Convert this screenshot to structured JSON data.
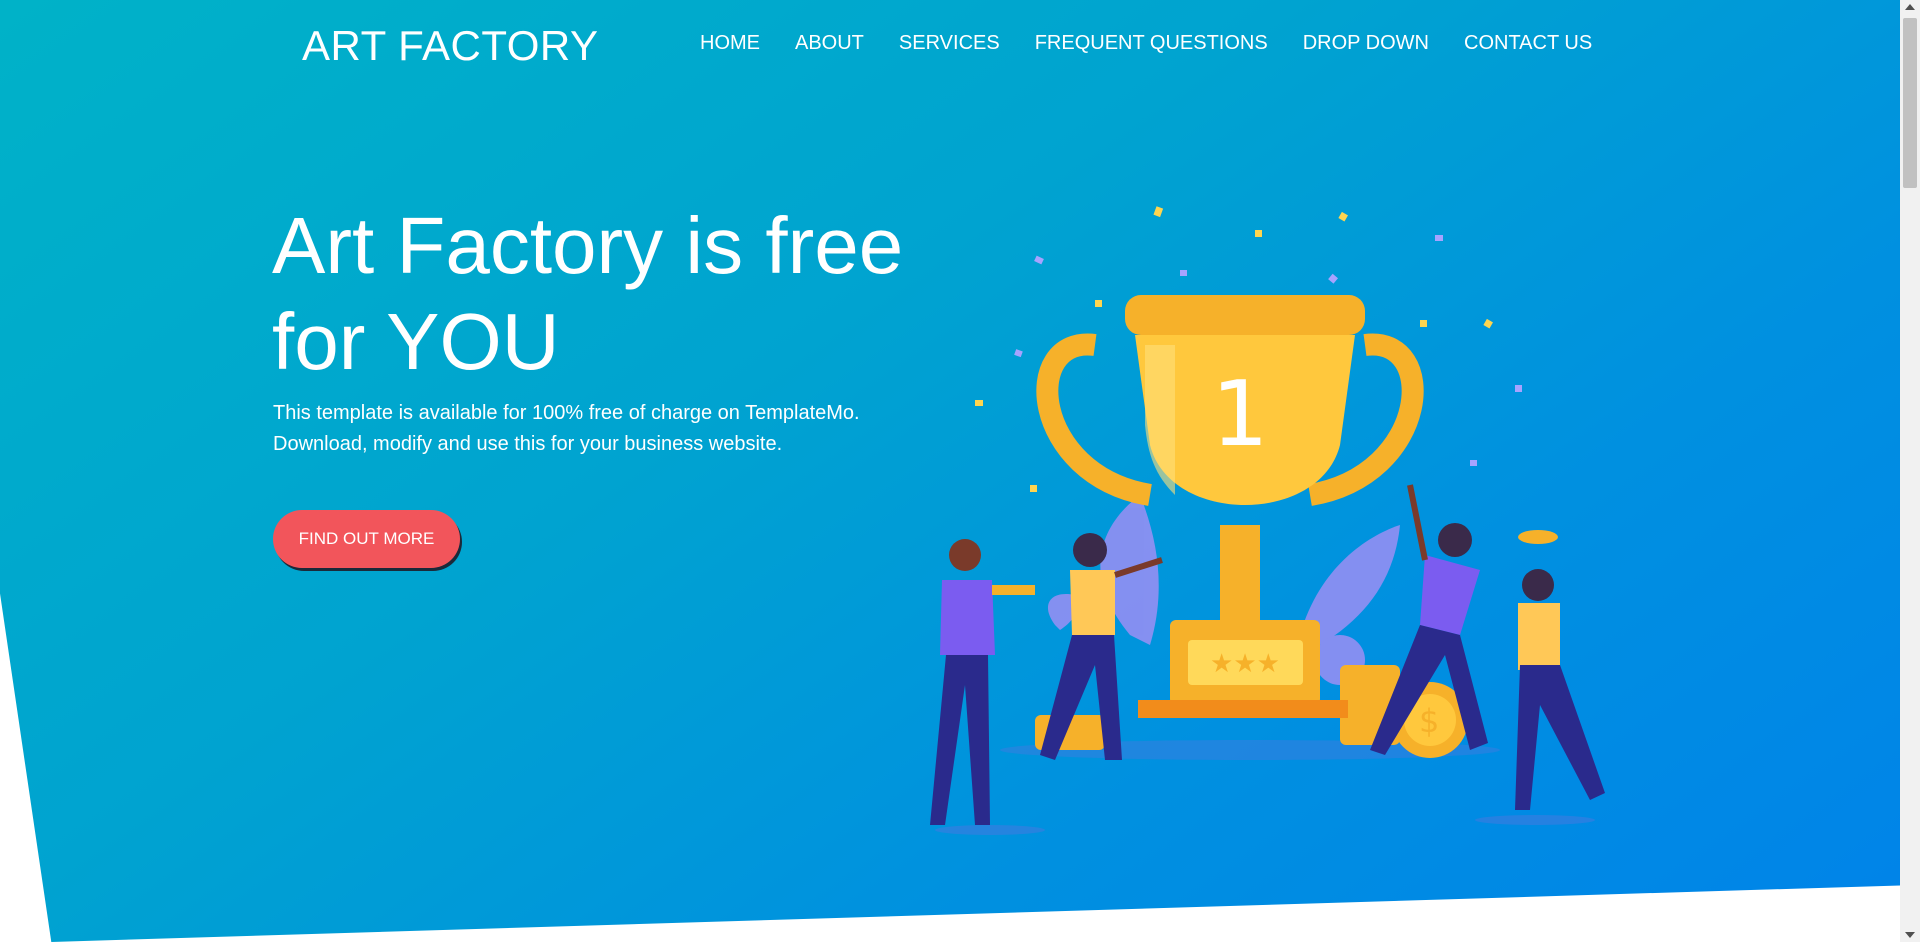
{
  "brand": {
    "logo_text": "ART FACTORY"
  },
  "nav": {
    "items": [
      {
        "label": "HOME"
      },
      {
        "label": "ABOUT"
      },
      {
        "label": "SERVICES"
      },
      {
        "label": "FREQUENT QUESTIONS"
      },
      {
        "label": "DROP DOWN"
      },
      {
        "label": "CONTACT US"
      }
    ]
  },
  "hero": {
    "headline": "Art Factory is free for YOU",
    "description": "This template is available for 100% free of charge on TemplateMo. Download, modify and use this for your business website.",
    "cta_label": "FIND OUT MORE",
    "trophy_number": "1"
  },
  "colors": {
    "gradient_start": "#00b2c8",
    "gradient_end": "#0083e9",
    "cta": "#f2555b",
    "trophy": "#ffc83d",
    "people_shirt": "#7b5cf0"
  },
  "icons": {
    "illustration": "trophy-celebration-illustration"
  }
}
